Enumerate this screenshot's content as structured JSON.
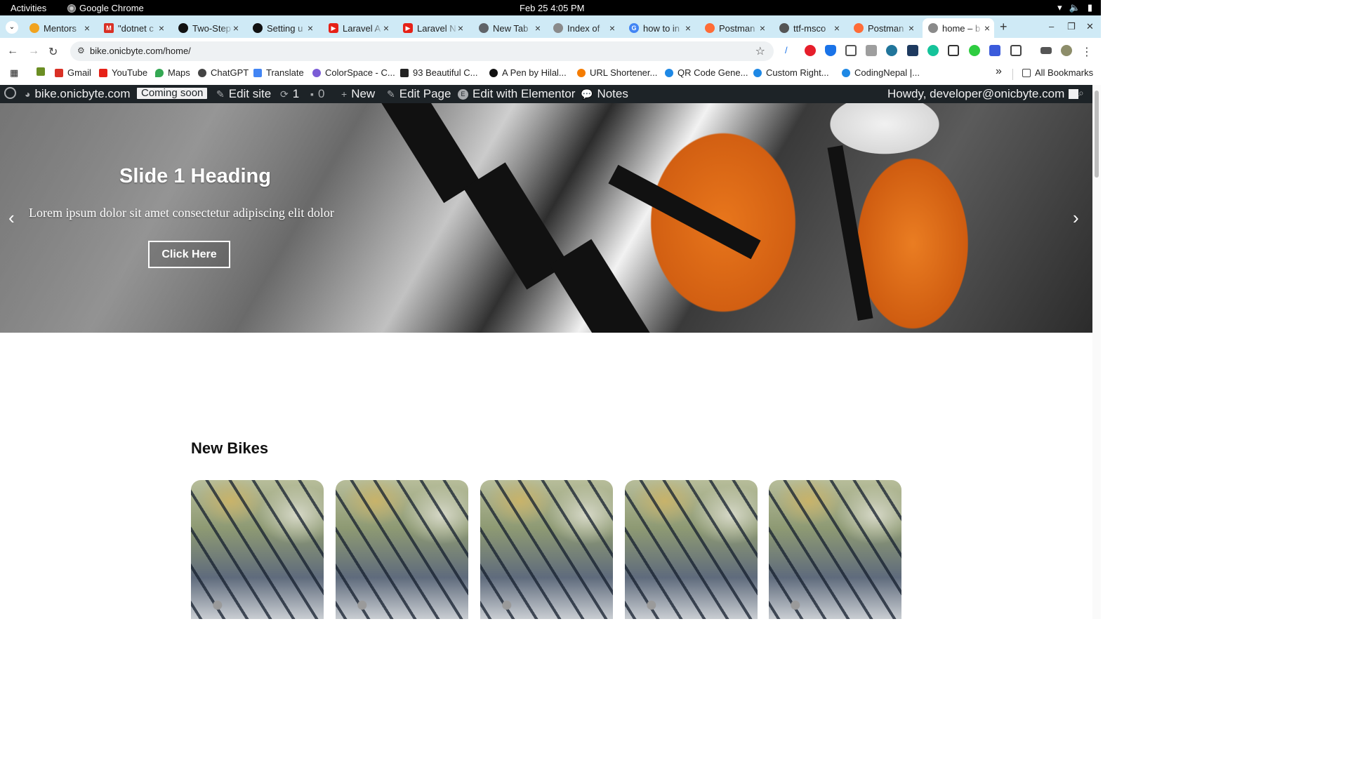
{
  "system_bar": {
    "activities": "Activities",
    "app_name": "Google Chrome",
    "clock": "Feb 25  4:05 PM"
  },
  "tabs": [
    {
      "title": "Mentors",
      "favicon": "home-icon",
      "color": "#f1a31f"
    },
    {
      "title": "\"dotnet c",
      "favicon": "gmail-icon",
      "color": "#d93025"
    },
    {
      "title": "Two-Step",
      "favicon": "github-icon",
      "color": "#111111"
    },
    {
      "title": "Setting u",
      "favicon": "github-icon",
      "color": "#111111"
    },
    {
      "title": "Laravel A",
      "favicon": "youtube-icon",
      "color": "#e62117"
    },
    {
      "title": "Laravel N",
      "favicon": "youtube-icon",
      "color": "#e62117"
    },
    {
      "title": "New Tab",
      "favicon": "chrome-icon",
      "color": "#5f6368"
    },
    {
      "title": "Index of",
      "favicon": "globe-icon",
      "color": "#8a8a8a"
    },
    {
      "title": "how to in",
      "favicon": "google-icon",
      "color": "#4285f4"
    },
    {
      "title": "Postman",
      "favicon": "postman-icon",
      "color": "#ff6c37"
    },
    {
      "title": "ttf-msco",
      "favicon": "globe-icon",
      "color": "#555555"
    },
    {
      "title": "Postman",
      "favicon": "postman-icon",
      "color": "#ff6c37"
    },
    {
      "title": "home – b",
      "favicon": "globe-icon",
      "color": "#8a8a8a",
      "active": true
    }
  ],
  "address_bar": {
    "url": "bike.onicbyte.com/home/"
  },
  "bookmarks": [
    {
      "label": "",
      "icon": "wordpress-icon",
      "color": "#6b8e23"
    },
    {
      "label": "Gmail",
      "icon": "gmail-icon",
      "color": "#d93025"
    },
    {
      "label": "YouTube",
      "icon": "youtube-icon",
      "color": "#e62117"
    },
    {
      "label": "Maps",
      "icon": "maps-icon",
      "color": "#34a853"
    },
    {
      "label": "ChatGPT",
      "icon": "chatgpt-icon",
      "color": "#444444"
    },
    {
      "label": "Translate",
      "icon": "translate-icon",
      "color": "#4285f4"
    },
    {
      "label": "ColorSpace - C...",
      "icon": "colorspace-icon",
      "color": "#7b5cd6"
    },
    {
      "label": "93 Beautiful C...",
      "icon": "bookmark-icon",
      "color": "#222222"
    },
    {
      "label": "A Pen by Hilal...",
      "icon": "codepen-icon",
      "color": "#111111"
    },
    {
      "label": "URL Shortener...",
      "icon": "link-icon",
      "color": "#f57c00"
    },
    {
      "label": "QR Code Gene...",
      "icon": "qr-icon",
      "color": "#1e88e5"
    },
    {
      "label": "Custom Right...",
      "icon": "codingnepal-icon",
      "color": "#1e88e5"
    },
    {
      "label": "CodingNepal |...",
      "icon": "codingnepal-icon",
      "color": "#1e88e5"
    }
  ],
  "bookmarks_more": "»",
  "all_bookmarks": "All Bookmarks",
  "wp_admin_bar": {
    "site_name": "bike.onicbyte.com",
    "coming_soon": "Coming soon",
    "edit_site": "Edit site",
    "updates_count": "1",
    "comments_count": "0",
    "new": "New",
    "edit_page": "Edit Page",
    "edit_with_elementor": "Edit with Elementor",
    "notes": "Notes",
    "howdy": "Howdy, developer@onicbyte.com"
  },
  "hero": {
    "heading": "Slide 1 Heading",
    "subtext": "Lorem ipsum dolor sit amet consectetur adipiscing elit dolor",
    "button": "Click Here",
    "prev_arrow": "‹",
    "next_arrow": "›"
  },
  "section": {
    "title": "New Bikes"
  }
}
